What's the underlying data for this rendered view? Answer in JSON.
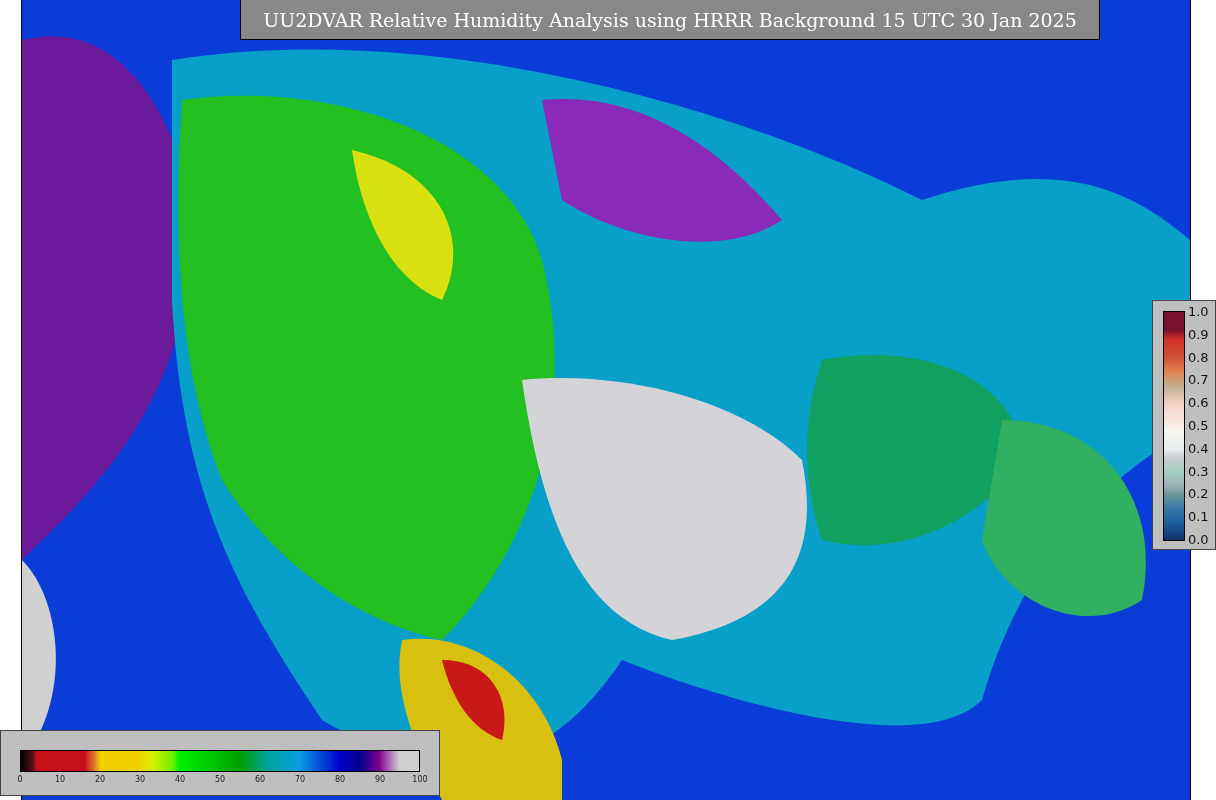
{
  "title": "UU2DVAR Relative Humidity Analysis using HRRR Background 15 UTC 30 Jan 2025",
  "humidity_colorbar": {
    "ticks": [
      "0",
      "10",
      "20",
      "30",
      "40",
      "50",
      "60",
      "70",
      "80",
      "90",
      "100"
    ]
  },
  "fraction_colorbar": {
    "ticks": [
      "1.0",
      "0.9",
      "0.8",
      "0.7",
      "0.6",
      "0.5",
      "0.4",
      "0.3",
      "0.2",
      "0.1",
      "0.0"
    ]
  }
}
